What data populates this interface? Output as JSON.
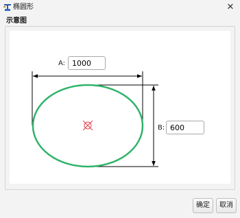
{
  "window": {
    "title": "椭圆形"
  },
  "group": {
    "title": "示意图"
  },
  "diagram": {
    "a_label": "A:",
    "a_value": "1000",
    "b_label": "B:",
    "b_value": "600"
  },
  "buttons": {
    "ok": "确定",
    "cancel": "取消"
  },
  "colors": {
    "ellipse": "#2fb36a",
    "center": "#e0434b",
    "dims": "#000000"
  }
}
